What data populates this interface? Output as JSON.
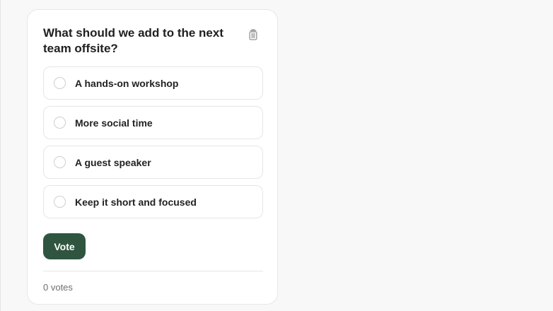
{
  "poll": {
    "question": "What should we add to the next team offsite?",
    "delete_icon": "trash-icon",
    "options": [
      {
        "label": "A hands-on workshop"
      },
      {
        "label": "More social time"
      },
      {
        "label": "A guest speaker"
      },
      {
        "label": "Keep it short and focused"
      }
    ],
    "vote_label": "Vote",
    "vote_count": "0 votes"
  },
  "colors": {
    "page_background": "#f8f8f8",
    "card_background": "#ffffff",
    "vote_button": "#2f5540",
    "border": "#e5e5e5"
  }
}
